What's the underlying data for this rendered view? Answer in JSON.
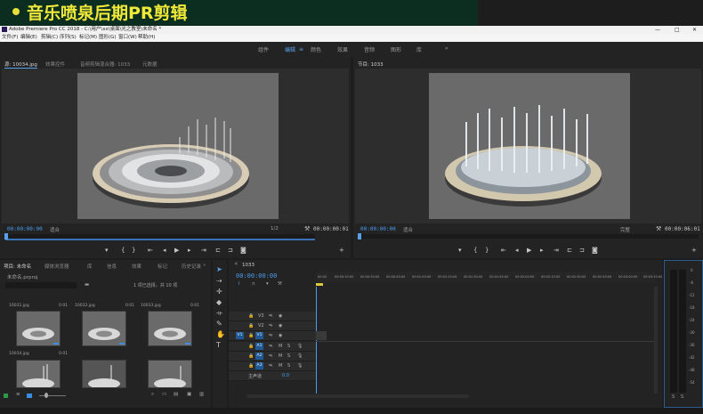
{
  "banner": {
    "title": "音乐喷泉后期PR剪辑"
  },
  "window": {
    "title": "Adobe Premiere Pro CC 2018 - C:\\用户\\xx\\桌面\\光之教室\\未命名 *",
    "minimize": "—",
    "maximize": "□",
    "close": "✕"
  },
  "menu": [
    "文件(F)",
    "编辑(E)",
    "剪辑(C)",
    "序列(S)",
    "标记(M)",
    "图形(G)",
    "窗口(W)",
    "帮助(H)"
  ],
  "workspaces": {
    "items": [
      "组件",
      "编辑",
      "颜色",
      "效果",
      "音频",
      "图形",
      "库"
    ],
    "active_index": 1,
    "more": "»"
  },
  "source_panel": {
    "tabs": [
      "源: 10034.jpg",
      "效果控件",
      "音频剪辑混合器: 1033",
      "元数据"
    ],
    "active_tab": 0,
    "timecode_in": "00:00:00:00",
    "fit": "适合",
    "quality": "1/2",
    "timecode_out": "00:00:00:01"
  },
  "program_panel": {
    "tabs": [
      "节目: 1033"
    ],
    "timecode_in": "00:00:00:00",
    "fit": "适合",
    "quality": "完整",
    "timecode_out": "00:00:06:01"
  },
  "project_panel": {
    "tabs": [
      "项目: 未命名",
      "媒体浏览器",
      "库",
      "信息",
      "效果",
      "标记",
      "历史记录"
    ],
    "more": "»",
    "project_file": "未命名.prproj",
    "item_count": "1 项已选择，共 10 项",
    "thumbs": [
      {
        "name": "10031.jpg",
        "dur": "0:01"
      },
      {
        "name": "10032.jpg",
        "dur": "0:01"
      },
      {
        "name": "10033.jpg",
        "dur": "0:01"
      },
      {
        "name": "10034.jpg",
        "dur": "0:01"
      },
      {
        "name": "",
        "dur": ""
      },
      {
        "name": "",
        "dur": ""
      }
    ]
  },
  "timeline": {
    "sequence_tab": "1033",
    "timecode": "00:00:00:00",
    "ruler": [
      "00:00",
      "00:00:15:00",
      "00:00:30:00",
      "00:00:45:00",
      "00:01:00:00",
      "00:01:15:00",
      "00:01:30:00",
      "00:01:45:00",
      "00:02:00:00",
      "00:02:15:00",
      "00:02:30:00",
      "00:02:45:00",
      "00:03:00:00",
      "00:03:15:00",
      "00:03:30:00",
      "00:03:45:00"
    ],
    "video_tracks": [
      "V3",
      "V2",
      "V1"
    ],
    "audio_tracks": [
      "A1",
      "A2",
      "A3"
    ],
    "source_patch_v": "V1",
    "master_label": "主声道",
    "master_value": "0.0",
    "mute": "M",
    "solo": "S"
  },
  "meter": {
    "labels": [
      "0",
      "-6",
      "-12",
      "-18",
      "-24",
      "-30",
      "-36",
      "-42",
      "-48",
      "-54"
    ],
    "solo_left": "S",
    "solo_right": "S"
  }
}
